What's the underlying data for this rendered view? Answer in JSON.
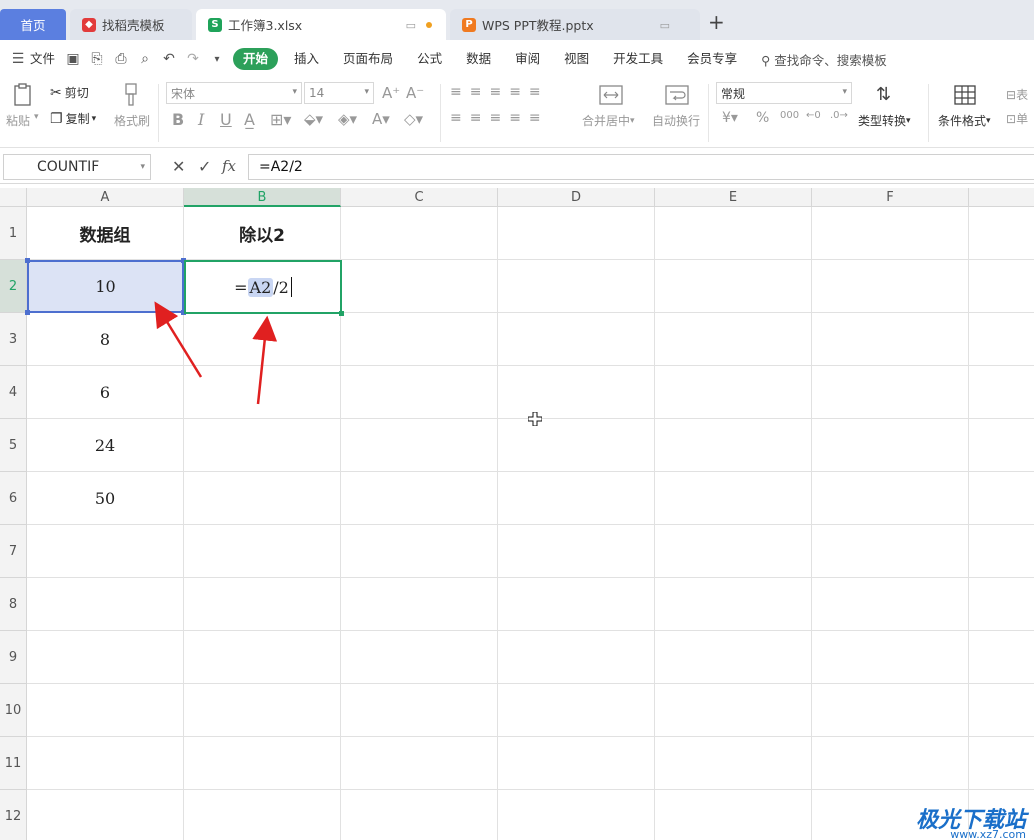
{
  "tabs": {
    "home": "首页",
    "template": "找稻壳模板",
    "workbook": "工作簿3.xlsx",
    "ppt": "WPS PPT教程.pptx"
  },
  "menu": {
    "file": "文件",
    "items": [
      "开始",
      "插入",
      "页面布局",
      "公式",
      "数据",
      "审阅",
      "视图",
      "开发工具",
      "会员专享"
    ],
    "search": "查找命令、搜索模板"
  },
  "ribbon": {
    "paste": "粘贴",
    "cut": "剪切",
    "copy": "复制",
    "format_painter": "格式刷",
    "font_name": "宋体",
    "font_size": "14",
    "merge": "合并居中",
    "wrap": "自动换行",
    "number_format": "常规",
    "type_convert": "类型转换",
    "cond_format": "条件格式",
    "table_style_partial": "表",
    "cell_partial": "单"
  },
  "formula_bar": {
    "name_box": "COUNTIF",
    "fx": "fx",
    "formula": "=A2/2"
  },
  "columns": [
    "A",
    "B",
    "C",
    "D",
    "E",
    "F"
  ],
  "rows": [
    "1",
    "2",
    "3",
    "4",
    "5",
    "6",
    "7",
    "8",
    "9",
    "10",
    "11",
    "12"
  ],
  "cells": {
    "A1": "数据组",
    "B1": "除以2",
    "A2": "10",
    "A3": "8",
    "A4": "6",
    "A5": "24",
    "A6": "50"
  },
  "editing": {
    "eq": "=",
    "ref": "A2",
    "rest": "/2"
  },
  "watermark": {
    "title": "极光下载站",
    "url": "www.xz7.com"
  },
  "colors": {
    "accent_green": "#21a366",
    "ref_blue": "#4d6fcf",
    "arrow_red": "#e02020"
  }
}
